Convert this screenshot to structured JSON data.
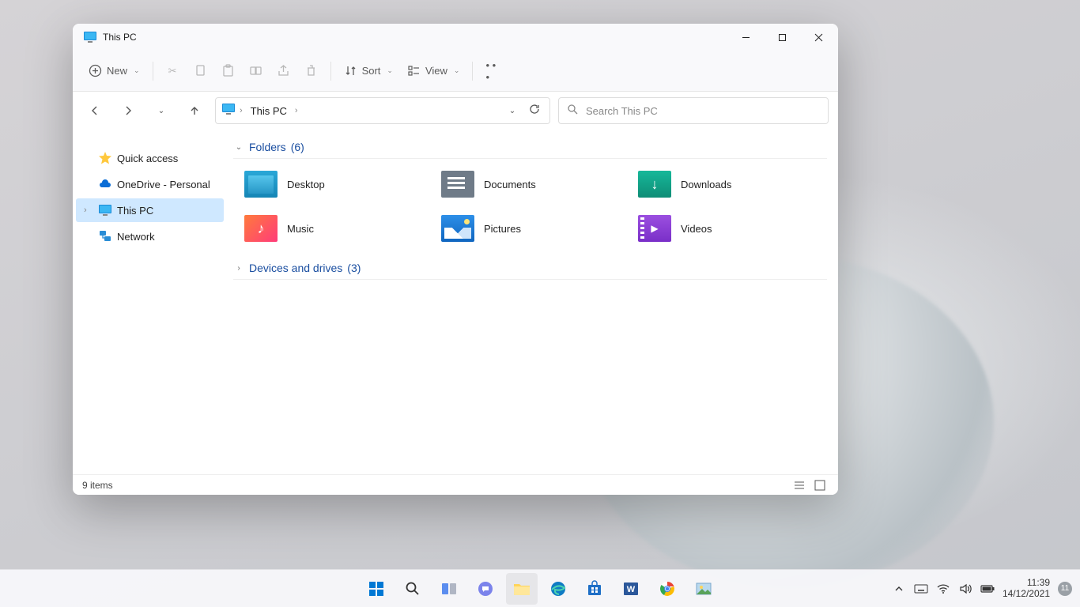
{
  "window": {
    "title": "This PC"
  },
  "toolbar": {
    "new_label": "New",
    "sort_label": "Sort",
    "view_label": "View"
  },
  "address": {
    "location": "This PC"
  },
  "search": {
    "placeholder": "Search This PC"
  },
  "sidebar": {
    "items": [
      {
        "label": "Quick access"
      },
      {
        "label": "OneDrive - Personal"
      },
      {
        "label": "This PC"
      },
      {
        "label": "Network"
      }
    ]
  },
  "groups": {
    "folders": {
      "label": "Folders",
      "count": "(6)"
    },
    "devices": {
      "label": "Devices and drives",
      "count": "(3)"
    }
  },
  "folders": [
    {
      "label": "Desktop"
    },
    {
      "label": "Documents"
    },
    {
      "label": "Downloads"
    },
    {
      "label": "Music"
    },
    {
      "label": "Pictures"
    },
    {
      "label": "Videos"
    }
  ],
  "status": {
    "items": "9 items"
  },
  "tray": {
    "time": "11:39",
    "date": "14/12/2021",
    "notif_count": "11"
  }
}
